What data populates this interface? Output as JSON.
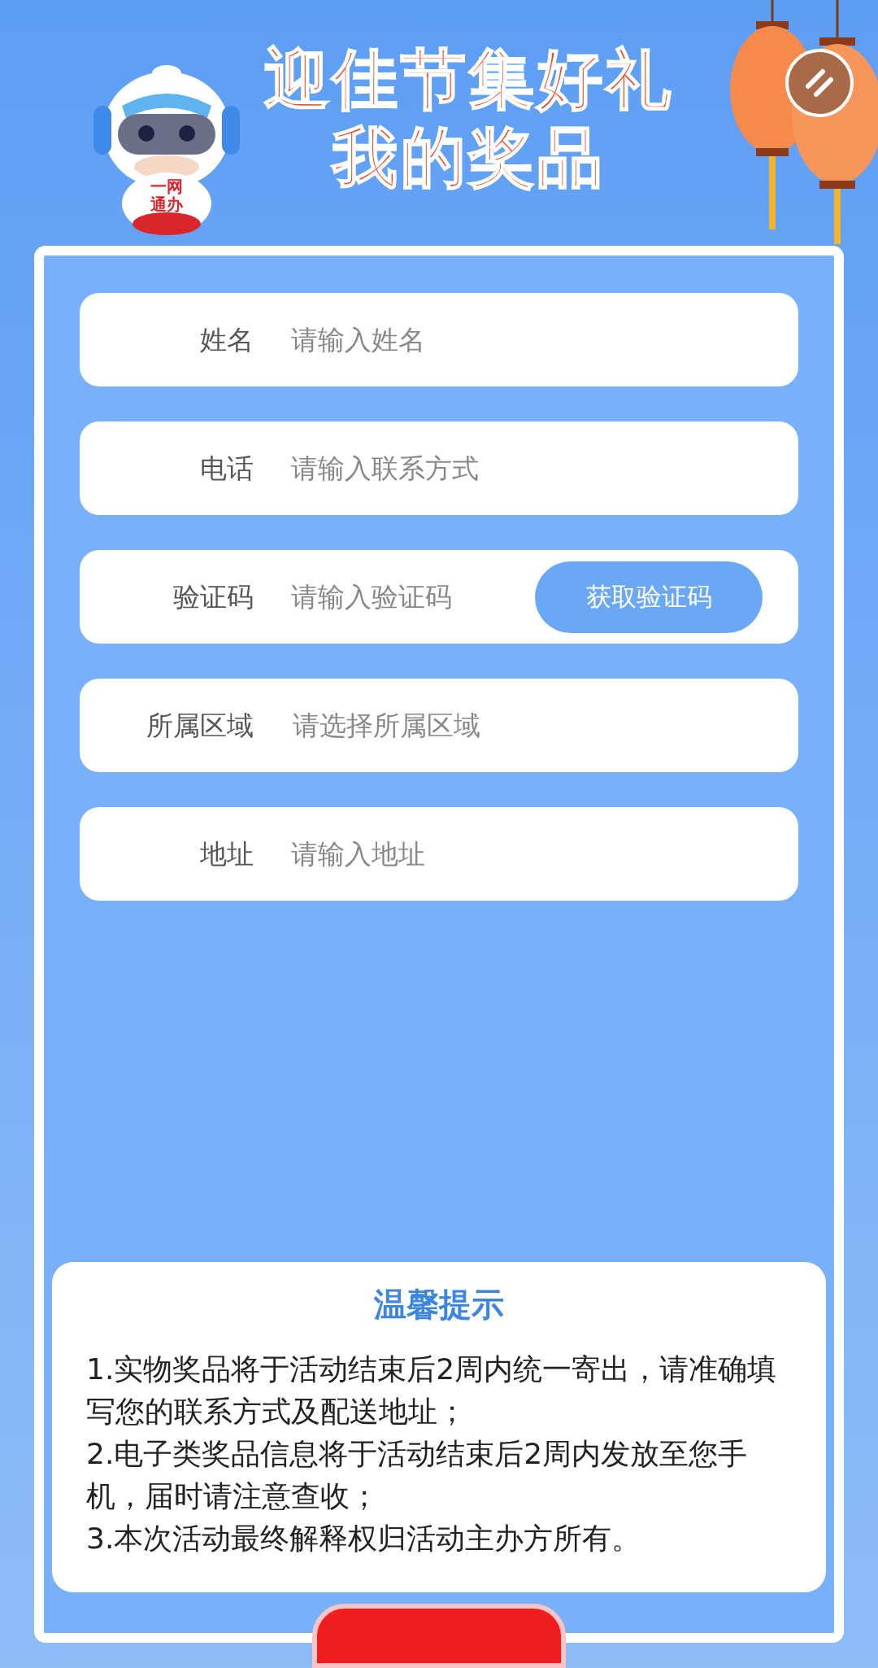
{
  "header": {
    "mascot_badge": [
      "一网",
      "通办"
    ],
    "title_lines": [
      "迎佳节集好礼",
      "我的奖品"
    ]
  },
  "form": {
    "fields": [
      {
        "kind": "input",
        "label": "姓名",
        "placeholder": "请输入姓名"
      },
      {
        "kind": "input",
        "label": "电话",
        "placeholder": "请输入联系方式"
      },
      {
        "kind": "input_with_button",
        "label": "验证码",
        "placeholder": "请输入验证码",
        "button": "获取验证码"
      },
      {
        "kind": "select",
        "label": "所属区域",
        "placeholder": "请选择所属区域"
      },
      {
        "kind": "input",
        "label": "地址",
        "placeholder": "请输入地址"
      }
    ]
  },
  "tips": {
    "title": "温馨提示",
    "items": [
      "1.实物奖品将于活动结束后2周内统一寄出，请准确填写您的联系方式及配送地址；",
      "2.电子类奖品信息将于活动结束后2周内发放至您手机，届时请注意查收；",
      "3.本次活动最终解释权归活动主办方所有。"
    ]
  }
}
